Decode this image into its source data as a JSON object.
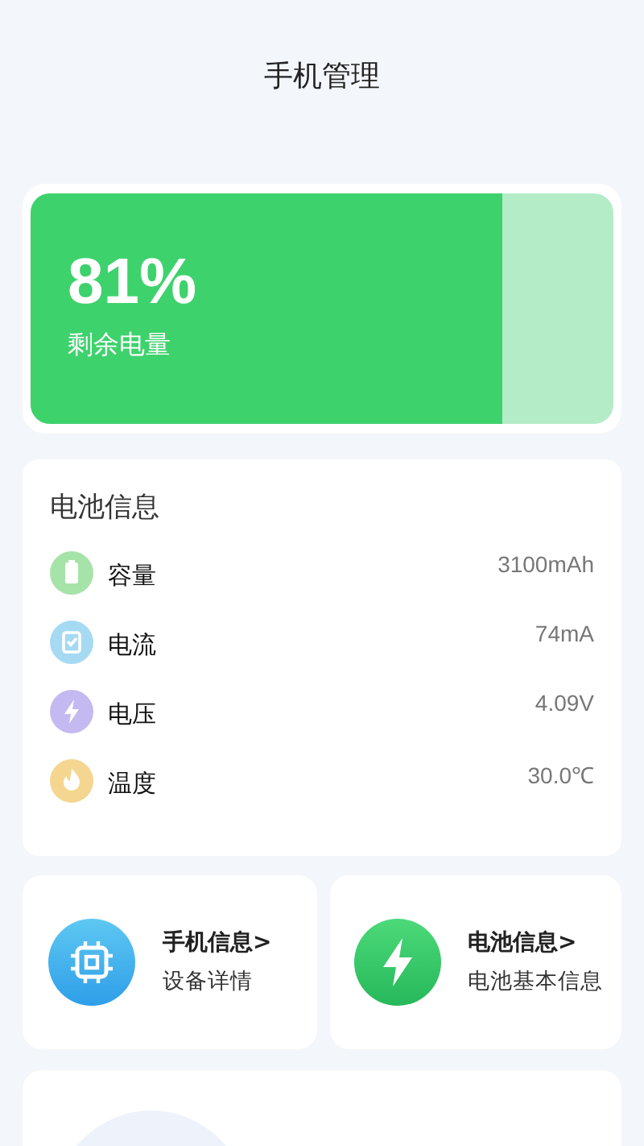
{
  "title": "手机管理",
  "battery": {
    "percent": "81%",
    "label": "剩余电量",
    "level": 0.81
  },
  "info": {
    "title": "电池信息",
    "items": [
      {
        "kind": "capacity",
        "label": "容量",
        "value": "3100mAh",
        "color": "#a6e3a8"
      },
      {
        "kind": "current",
        "label": "电流",
        "value": "74mA",
        "color": "#a6daf3"
      },
      {
        "kind": "voltage",
        "label": "电压",
        "value": "4.09V",
        "color": "#c4b9f1"
      },
      {
        "kind": "temperature",
        "label": "温度",
        "value": "30.0℃",
        "color": "#f4d690"
      }
    ]
  },
  "shortcuts": [
    {
      "kind": "phone",
      "title": "手机信息>",
      "subtitle": "设备详情"
    },
    {
      "kind": "battery",
      "title": "电池信息>",
      "subtitle": "电池基本信息"
    }
  ]
}
